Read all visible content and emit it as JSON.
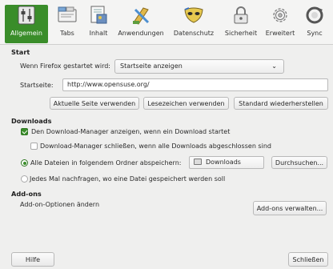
{
  "toolbar": {
    "items": [
      {
        "label": "Allgemein",
        "icon": "switches-icon"
      },
      {
        "label": "Tabs",
        "icon": "tabs-icon"
      },
      {
        "label": "Inhalt",
        "icon": "content-icon"
      },
      {
        "label": "Anwendungen",
        "icon": "applications-icon"
      },
      {
        "label": "Datenschutz",
        "icon": "privacy-mask-icon"
      },
      {
        "label": "Sicherheit",
        "icon": "lock-icon"
      },
      {
        "label": "Erweitert",
        "icon": "gear-icon"
      },
      {
        "label": "Sync",
        "icon": "sync-icon"
      }
    ],
    "active_index": 0,
    "accent_color": "#3a8d2a"
  },
  "start": {
    "title": "Start",
    "when_label": "Wenn Firefox gestartet wird:",
    "when_value": "Startseite anzeigen",
    "homepage_label": "Startseite:",
    "homepage_value": "http://www.opensuse.org/",
    "btn_current": "Aktuelle Seite verwenden",
    "btn_bookmark": "Lesezeichen verwenden",
    "btn_default": "Standard wiederherstellen"
  },
  "downloads": {
    "title": "Downloads",
    "show_manager": "Den Download-Manager anzeigen, wenn ein Download startet",
    "close_manager": "Download-Manager schließen, wenn alle Downloads abgeschlossen sind",
    "save_in": "Alle Dateien in folgendem Ordner abspeichern:",
    "folder": "Downloads",
    "browse": "Durchsuchen...",
    "ask": "Jedes Mal nachfragen, wo eine Datei gespeichert werden soll"
  },
  "addons": {
    "title": "Add-ons",
    "desc": "Add-on-Optionen ändern",
    "manage": "Add-ons verwalten..."
  },
  "footer": {
    "help": "Hilfe",
    "close": "Schließen"
  }
}
